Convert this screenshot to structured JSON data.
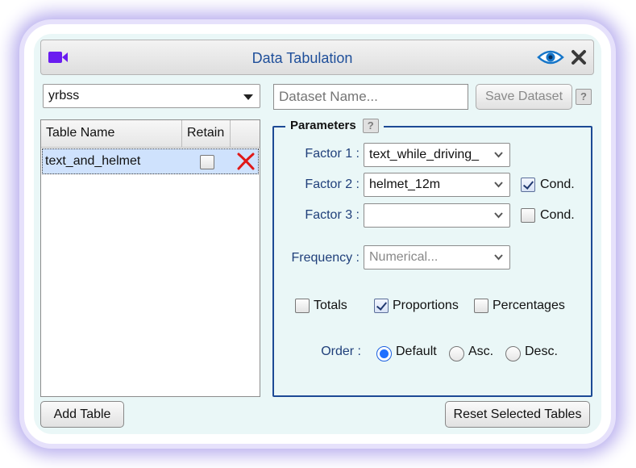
{
  "window": {
    "title": "Data Tabulation",
    "icons": {
      "app": "video-camera-icon",
      "view": "eye-icon",
      "close": "close-icon"
    },
    "colors": {
      "accent": "#1f4f9a",
      "icon_purple": "#6a1cf0",
      "selection": "#cfe2fd",
      "delete_red": "#e01818"
    }
  },
  "dataset": {
    "selected": "yrbss",
    "name_placeholder": "Dataset Name...",
    "save_label": "Save Dataset",
    "help": "?"
  },
  "tables": {
    "headers": {
      "name": "Table Name",
      "retain": "Retain"
    },
    "rows": [
      {
        "name": "text_and_helmet",
        "retain": false,
        "selected": true
      }
    ],
    "add_label": "Add Table",
    "reset_label": "Reset Selected Tables"
  },
  "parameters": {
    "title": "Parameters",
    "help": "?",
    "factor1": {
      "label": "Factor 1 :",
      "value": "text_while_driving_"
    },
    "factor2": {
      "label": "Factor 2 :",
      "value": "helmet_12m",
      "cond_label": "Cond.",
      "cond_checked": true
    },
    "factor3": {
      "label": "Factor 3 :",
      "value": "",
      "cond_label": "Cond.",
      "cond_checked": false
    },
    "frequency": {
      "label": "Frequency :",
      "value": "Numerical..."
    },
    "options": {
      "totals": {
        "label": "Totals",
        "checked": false
      },
      "proportions": {
        "label": "Proportions",
        "checked": true
      },
      "percentages": {
        "label": "Percentages",
        "checked": false
      }
    },
    "order": {
      "label": "Order :",
      "choices": [
        "Default",
        "Asc.",
        "Desc."
      ],
      "selected": "Default"
    }
  }
}
